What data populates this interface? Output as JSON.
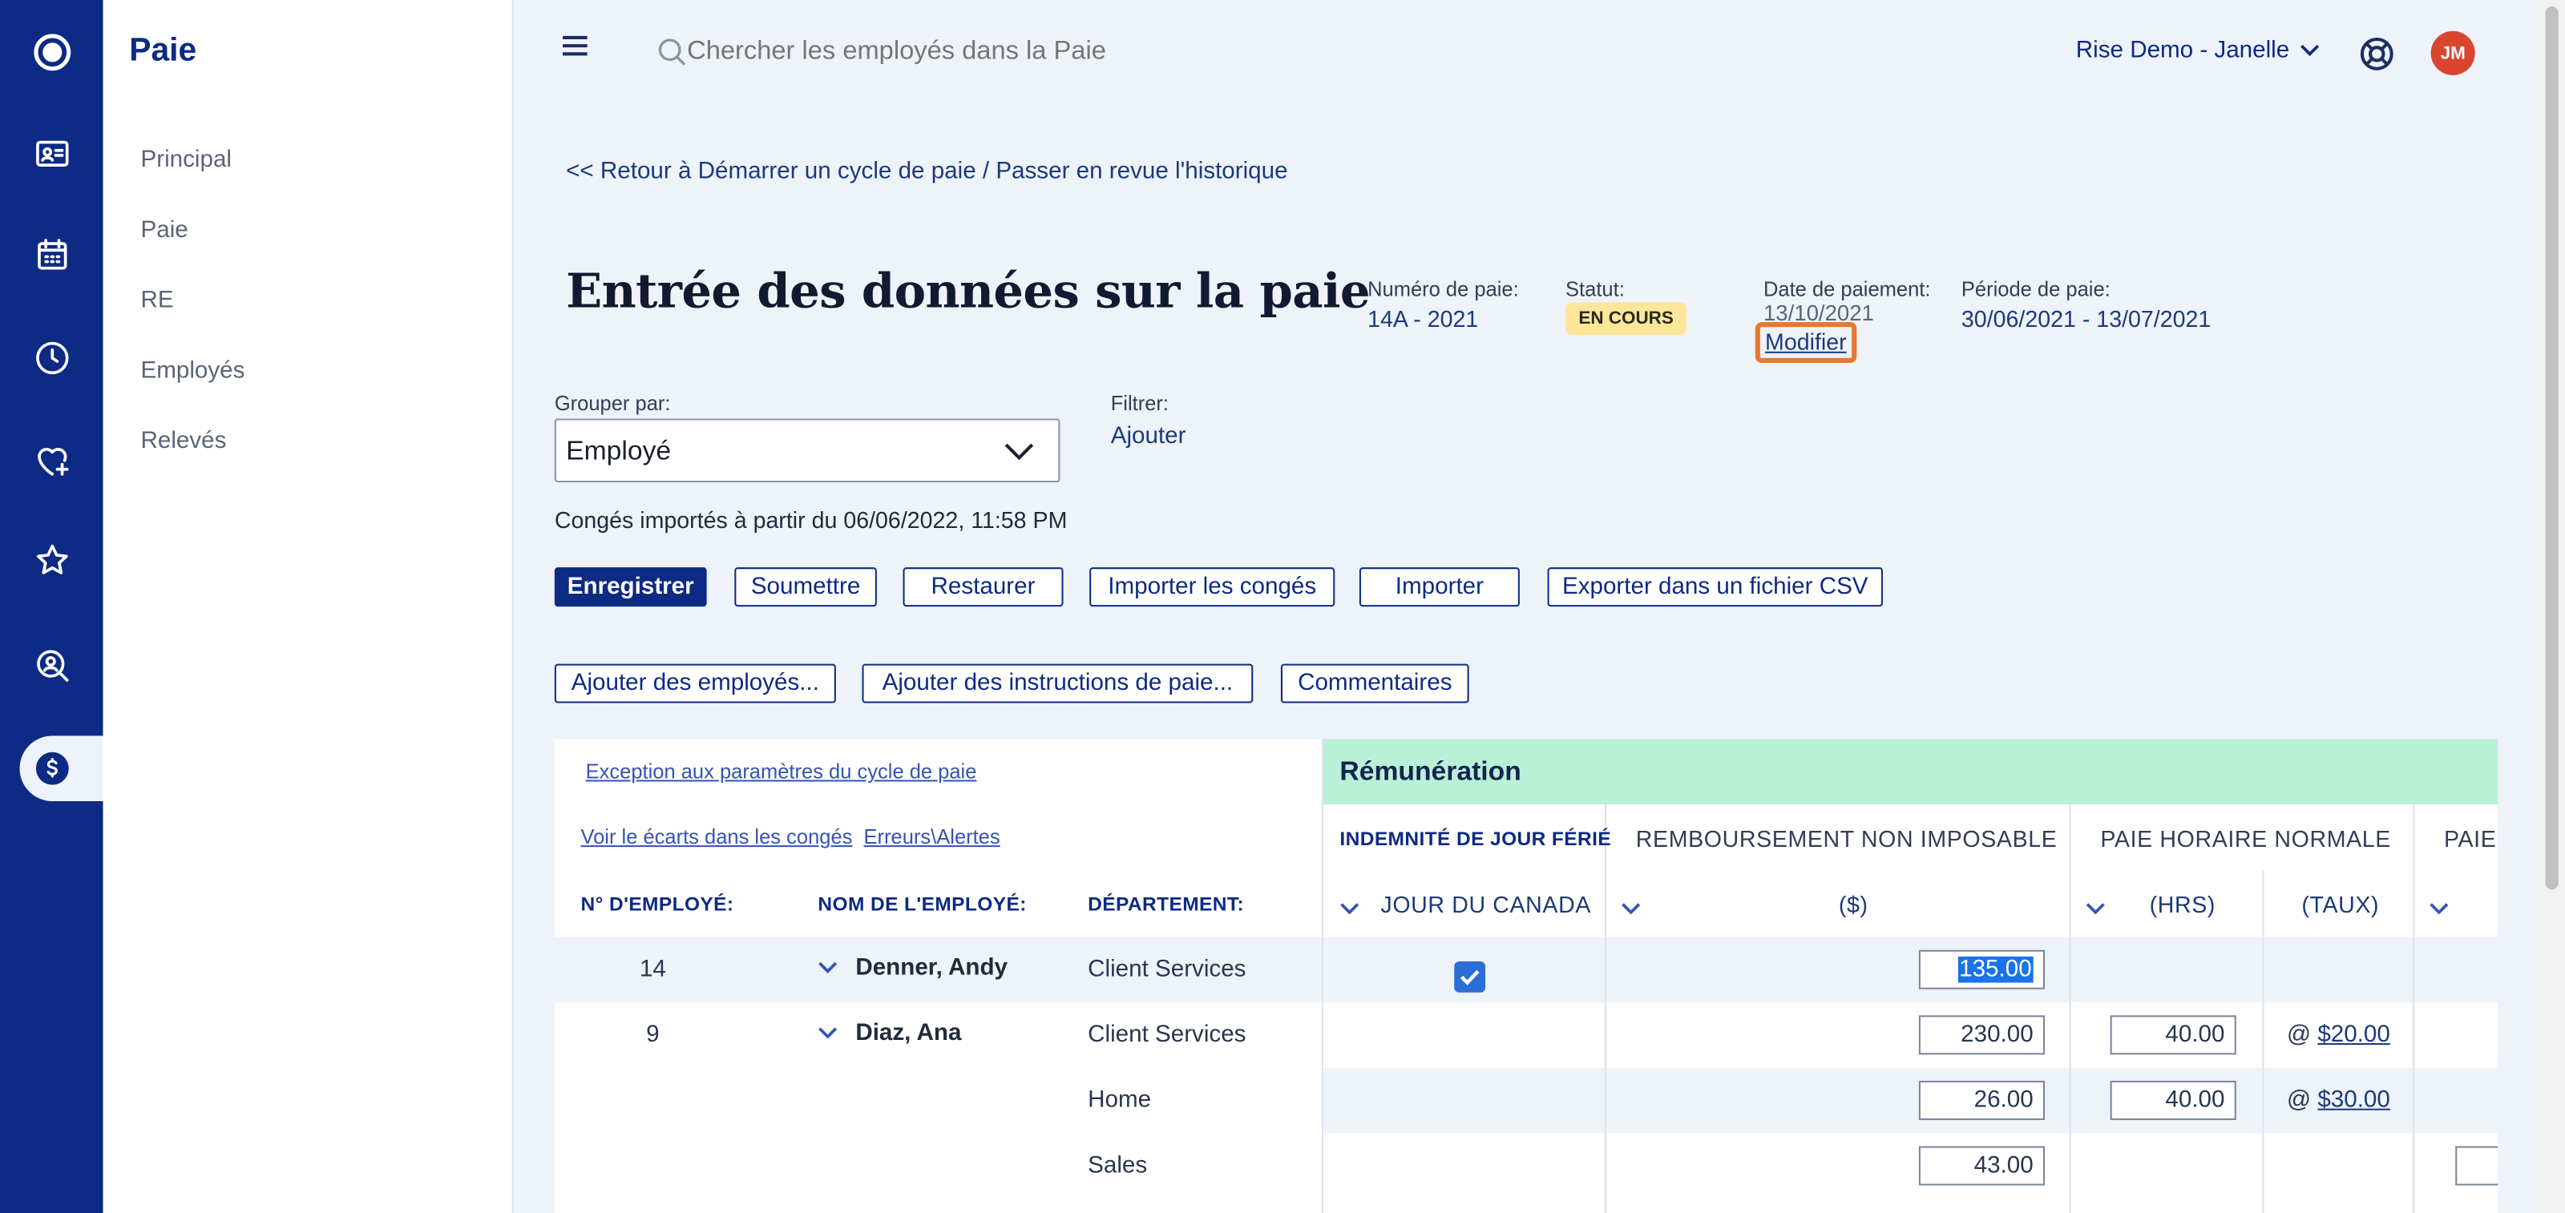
{
  "nav_rail": {
    "icons": [
      "logo-icon",
      "id-card-icon",
      "calendar-icon",
      "clock-icon",
      "heart-plus-icon",
      "star-badge-icon",
      "search-person-icon",
      "dollar-icon"
    ],
    "active": "dollar-icon"
  },
  "sidebar": {
    "title": "Paie",
    "items": [
      {
        "label": "Principal"
      },
      {
        "label": "Paie"
      },
      {
        "label": "RE"
      },
      {
        "label": "Employés"
      },
      {
        "label": "Relevés"
      }
    ]
  },
  "header": {
    "search_placeholder": "Chercher les employés dans la Paie",
    "account": "Rise Demo - Janelle",
    "avatar_initials": "JM"
  },
  "breadcrumb": "<< Retour à Démarrer un cycle de paie / Passer en revue l'historique",
  "page": {
    "title": "Entrée des données sur la paie"
  },
  "meta": {
    "pay_number": {
      "label": "Numéro de paie:",
      "value": "14A - 2021"
    },
    "status": {
      "label": "Statut:",
      "value": "EN COURS"
    },
    "pay_date": {
      "label": "Date de paiement:",
      "value": "13/10/2021",
      "action": "Modifier"
    },
    "period": {
      "label": "Période de paie:",
      "value": "30/06/2021 - 13/07/2021"
    }
  },
  "group_by": {
    "label": "Grouper par:",
    "value": "Employé"
  },
  "filter": {
    "label": "Filtrer:",
    "action": "Ajouter"
  },
  "import_note": "Congés importés à partir du 06/06/2022, 11:58 PM",
  "toolbar1": {
    "save": "Enregistrer",
    "submit": "Soumettre",
    "restore": "Restaurer",
    "import_leave": "Importer les congés",
    "import": "Importer",
    "export_csv": "Exporter dans un fichier CSV"
  },
  "toolbar2": {
    "add_employees": "Ajouter des employés...",
    "add_instructions": "Ajouter des instructions de paie...",
    "comments": "Commentaires"
  },
  "links": {
    "exception": "Exception aux paramètres du cycle de paie",
    "gaps": "Voir le écarts dans les congés",
    "errors": "Erreurs\\Alertes"
  },
  "table": {
    "col_emp_no": "N° D'EMPLOYÉ:",
    "col_emp_name": "NOM DE L'EMPLOYÉ:",
    "col_dept": "DÉPARTEMENT:",
    "group_header": "Rémunération",
    "col_holiday": "INDEMNITÉ DE JOUR FÉRIÉ",
    "col_holiday_sub": "JOUR DU CANADA",
    "col_reimb": "REMBOURSEMENT NON IMPOSABLE",
    "col_reimb_sub": "($)",
    "col_hourly": "PAIE HORAIRE NORMALE",
    "col_hourly_hrs": "(HRS)",
    "col_hourly_rate": "(TAUX)",
    "col_next": "PAIE",
    "rows": [
      {
        "emp_no": "14",
        "name": "Denner, Andy",
        "dept": "Client Services",
        "holiday_checked": true,
        "reimb": "135.00",
        "hours": "",
        "rate": ""
      },
      {
        "emp_no": "9",
        "name": "Diaz, Ana",
        "dept": "Client Services",
        "holiday_checked": false,
        "reimb": "230.00",
        "hours": "40.00",
        "rate": "$20.00"
      },
      {
        "emp_no": "",
        "name": "",
        "dept": "Home",
        "holiday_checked": false,
        "reimb": "26.00",
        "hours": "40.00",
        "rate": "$30.00"
      },
      {
        "emp_no": "",
        "name": "",
        "dept": "Sales",
        "holiday_checked": false,
        "reimb": "43.00",
        "hours": "",
        "rate": ""
      }
    ],
    "rate_prefix": "@"
  },
  "colors": {
    "rail": "#0d2a84",
    "accent": "#0d2a84",
    "status_badge": "#fde69a",
    "group_header": "#b9f0d8",
    "highlight": "#1a73e8",
    "avatar": "#d9452f",
    "focus_ring": "#e8772e"
  }
}
